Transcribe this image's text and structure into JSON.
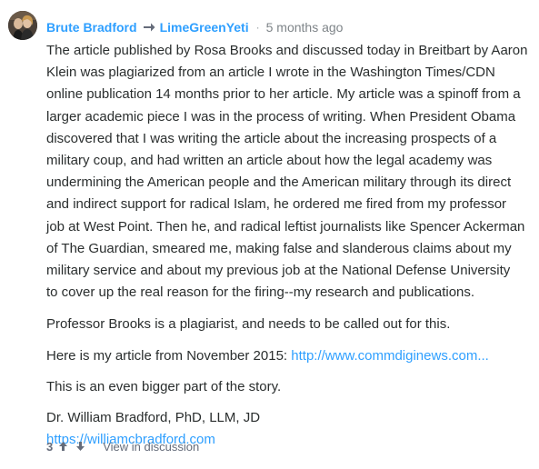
{
  "comment": {
    "author": "Brute Bradford",
    "reply_to": "LimeGreenYeti",
    "separator": "·",
    "timestamp": "5 months ago",
    "paragraphs": {
      "p1_lines": [
        "The article published by Rosa Brooks and discussed today in Breitbart by Aaron",
        "Klein was plagiarized from an article I wrote in the Washington Times/CDN",
        "online publication 14 months prior to her article. My article was a spinoff from a",
        "larger academic piece I was in the process of writing. When President Obama",
        "discovered that I was writing the article about the increasing prospects of a",
        "military coup, and had written an article about how the legal academy was",
        "undermining the American people and the American military through its direct",
        "and indirect support for radical Islam, he ordered me fired from my professor",
        "job at West Point. Then he, and radical leftist journalists like Spencer Ackerman",
        "of The Guardian, smeared me, making false and slanderous claims about my",
        "military service and about my previous job at the National Defense University",
        "to cover up the real reason for the firing--my research and publications."
      ],
      "p2": "Professor Brooks is a plagiarist, and needs to be called out for this.",
      "p3_prefix": "Here is my article from November 2015: ",
      "p3_link": "http://www.commdiginews.com...",
      "p4": "This is an even bigger part of the story.",
      "signature_name": "Dr. William Bradford, PhD, LLM, JD",
      "signature_link": "https://williamcbradford.com"
    },
    "footer": {
      "vote_count": "3",
      "upvote_icon": "arrow-up-icon",
      "downvote_icon": "arrow-down-icon",
      "view_discussion": "View in discussion"
    },
    "colors": {
      "link": "#2e9fff",
      "text": "#2a2e2e",
      "muted": "#656c7a"
    }
  }
}
